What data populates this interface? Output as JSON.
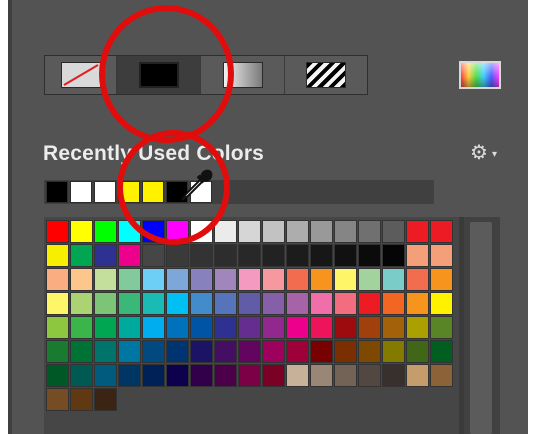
{
  "panel": {
    "section_title": "Recently Used Colors",
    "settings_icon": "gear-icon",
    "picker_icon": "color-picker-icon"
  },
  "toolbar": {
    "buttons": [
      {
        "name": "no-color-button",
        "icon": "no-color-icon"
      },
      {
        "name": "solid-color-button",
        "icon": "solid-color-icon",
        "selected": true
      },
      {
        "name": "gradient-button",
        "icon": "gradient-icon"
      },
      {
        "name": "pattern-button",
        "icon": "pattern-icon"
      }
    ]
  },
  "recent_colors": [
    "#000000",
    "#ffffff",
    "#ffffff",
    "#fff200",
    "#fff200",
    "#000000",
    "#ffffff"
  ],
  "swatches": [
    [
      "#ff0000",
      "#ffff00",
      "#00ff00",
      "#00ffff",
      "#0000ff",
      "#ff00ff",
      "#ffffff",
      "#ebebeb",
      "#d6d6d6",
      "#c2c2c2",
      "#adadad",
      "#999999",
      "#858585",
      "#707070",
      "#5c5c5c",
      "#ed1c24",
      "#ed1c24"
    ],
    [
      "#f7ee00",
      "#00a651",
      "#2e3192",
      "#ec008c",
      "#464646",
      "#3a3a3a",
      "#333333",
      "#2d2d2d",
      "#282828",
      "#222222",
      "#1c1c1c",
      "#171717",
      "#111111",
      "#0b0b0b",
      "#050505",
      "#f3a07a",
      "#f3a07a"
    ],
    [
      "#f9ad81",
      "#fdc68a",
      "#c4df9b",
      "#82ca9c",
      "#6dcff6",
      "#7da7d9",
      "#8781bd",
      "#a186be",
      "#f49ac1",
      "#f6989d",
      "#f26c4f",
      "#f7941d",
      "#fff568",
      "#a3d39c",
      "#7accc8",
      "#f26c4f",
      "#f7941d"
    ],
    [
      "#fff568",
      "#acd373",
      "#7cc576",
      "#3bb878",
      "#1abbb4",
      "#00bff3",
      "#438ccb",
      "#5574b9",
      "#605ca8",
      "#855fa8",
      "#a763a8",
      "#f06eaa",
      "#f26d7d",
      "#ed1c24",
      "#f26522",
      "#f7941d",
      "#fff200"
    ],
    [
      "#8dc63f",
      "#39b54a",
      "#00a651",
      "#00a99d",
      "#00aeef",
      "#0072bc",
      "#0054a6",
      "#2e3192",
      "#662d91",
      "#92278f",
      "#ec008c",
      "#ed145b",
      "#9e0b0f",
      "#a0410d",
      "#a36209",
      "#aba000",
      "#598527"
    ],
    [
      "#197b30",
      "#007236",
      "#00746b",
      "#0076a3",
      "#004a80",
      "#003471",
      "#1b1464",
      "#440e62",
      "#630460",
      "#9e005d",
      "#9e0039",
      "#790000",
      "#7b2e00",
      "#7d4900",
      "#827b00",
      "#406618",
      "#005e20"
    ],
    [
      "#005826",
      "#005952",
      "#005b7f",
      "#003663",
      "#002157",
      "#0d004c",
      "#32004b",
      "#4b0049",
      "#7b0046",
      "#7a0026",
      "#c7b299",
      "#998675",
      "#736357",
      "#534741",
      "#37302d",
      "#c69c6d",
      "#8c6239"
    ],
    [
      "#754c24",
      "#603913",
      "#3c2415"
    ]
  ]
}
